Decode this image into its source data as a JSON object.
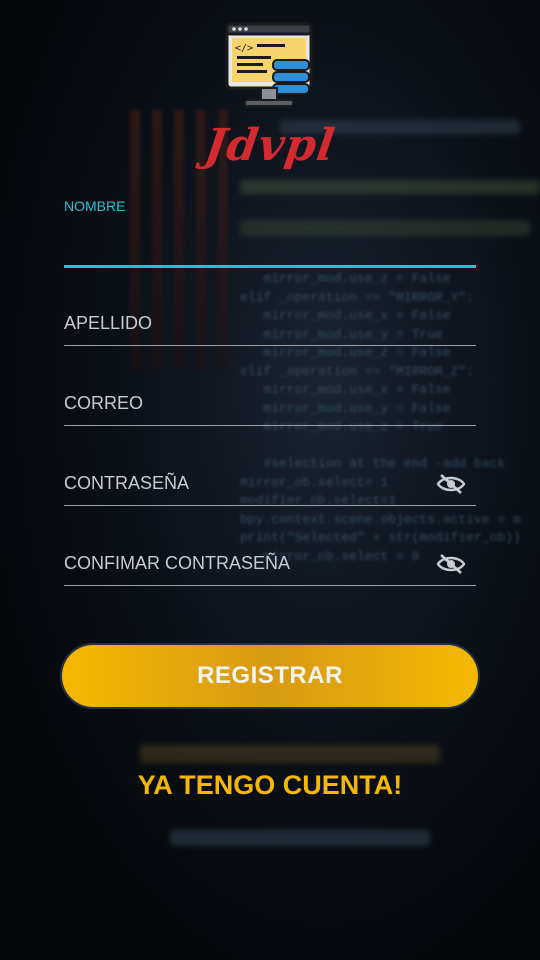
{
  "app": {
    "brand": "Jdvpl"
  },
  "form": {
    "fields": [
      {
        "label": "NOMBRE",
        "value": "",
        "active": true
      },
      {
        "label": "APELLIDO",
        "value": ""
      },
      {
        "label": "CORREO",
        "value": ""
      },
      {
        "label": "CONTRASEÑA",
        "value": "",
        "icon": "eye-off-icon"
      },
      {
        "label": "CONFIMAR CONTRASEÑA",
        "value": "",
        "icon": "eye-off-icon"
      }
    ],
    "submit_label": "REGISTRAR",
    "login_link": "YA TENGO CUENTA!"
  },
  "colors": {
    "accent": "#27c1d3",
    "button": "#f5b800",
    "brand": "#d32a2f",
    "link": "#f5b800"
  }
}
